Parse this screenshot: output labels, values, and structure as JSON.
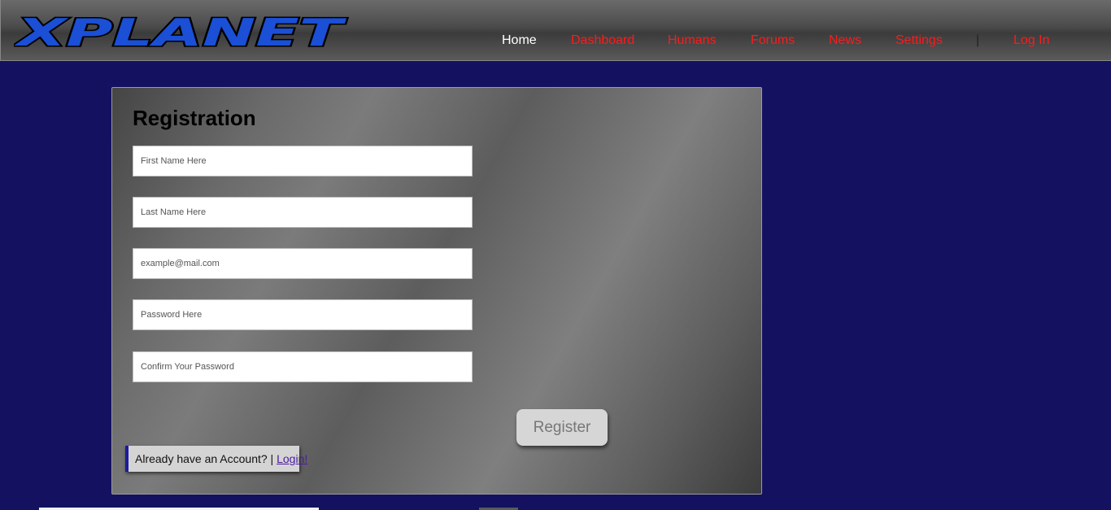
{
  "brand": {
    "logo_text": "XPLANET",
    "logo_fill": "#1a4fd6",
    "logo_outline": "#000000"
  },
  "nav": {
    "home": "Home",
    "dashboard": "Dashboard",
    "humans": "Humans",
    "forums": "Forums",
    "news": "News",
    "settings": "Settings",
    "separator": "|",
    "login": "Log In",
    "link_color": "#ff1a1a",
    "active_color": "#ffffff"
  },
  "registration": {
    "title": "Registration",
    "first_name": {
      "placeholder": "First Name Here",
      "value": ""
    },
    "last_name": {
      "placeholder": "Last Name Here",
      "value": ""
    },
    "email": {
      "placeholder": "example@mail.com",
      "value": ""
    },
    "password": {
      "placeholder": "Password Here",
      "value": ""
    },
    "confirm_password": {
      "placeholder": "Confirm Your Password",
      "value": ""
    },
    "register_label": "Register",
    "account_prompt": "Already have an Account? |",
    "login_link": "Login!"
  },
  "colors": {
    "page_background": "#131160",
    "accent_bar": "#1b1b9c"
  }
}
